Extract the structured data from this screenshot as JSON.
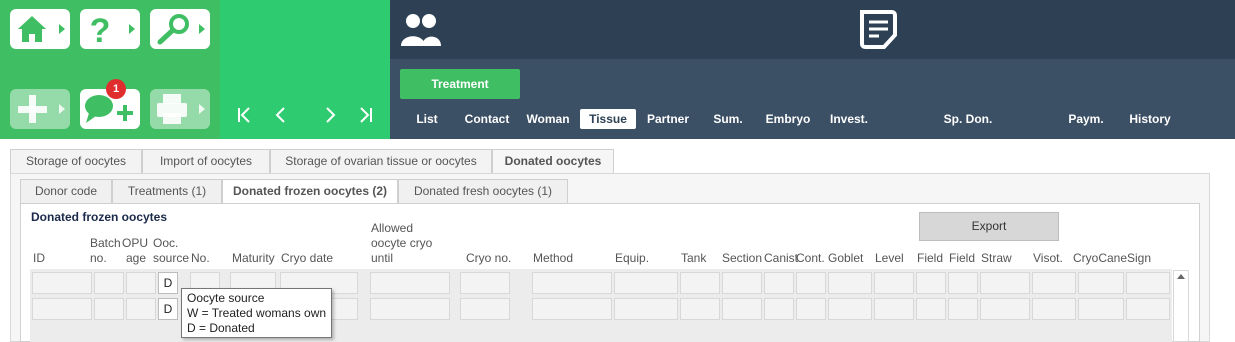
{
  "action_panel": {
    "badge_count": "1",
    "buttons": [
      {
        "icon": "home-icon"
      },
      {
        "icon": "help-icon"
      },
      {
        "icon": "search-icon"
      },
      {
        "icon": "add-icon",
        "disabled": true
      },
      {
        "icon": "add-comment-icon"
      },
      {
        "icon": "print-icon",
        "disabled": true
      }
    ]
  },
  "nav": {
    "buttons": [
      {
        "icon": "first-record-icon"
      },
      {
        "icon": "previous-record-icon"
      },
      {
        "icon": "next-record-icon"
      },
      {
        "icon": "last-record-icon"
      }
    ]
  },
  "header": {
    "treatment_label": "Treatment",
    "active_tab": "Tissue",
    "tabs": [
      "List",
      "Contact",
      "Woman",
      "Tissue",
      "Partner",
      "Sum.",
      "Embryo",
      "Invest.",
      "Sp. Don.",
      "Paym.",
      "History"
    ]
  },
  "tabs_level1": {
    "active": "Donated oocytes",
    "items": [
      "Storage of oocytes",
      "Import of oocytes",
      "Storage of ovarian tissue or oocytes",
      "Donated oocytes"
    ]
  },
  "tabs_level2": {
    "active": "Donated frozen oocytes (2)",
    "items": [
      "Donor code",
      "Treatments (1)",
      "Donated frozen oocytes (2)",
      "Donated fresh oocytes (1)"
    ]
  },
  "section": {
    "title": "Donated frozen oocytes",
    "export_label": "Export"
  },
  "table": {
    "headers": {
      "id": "ID",
      "batch_no_1": "Batch",
      "batch_no_2": "no.",
      "opu_age_1": "OPU",
      "opu_age_2": "age",
      "ooc_source_1": "Ooc.",
      "ooc_source_2": "source",
      "no": "No.",
      "maturity": "Maturity",
      "cryo_date": "Cryo date",
      "allowed_1": "Allowed",
      "allowed_2": "oocyte cryo",
      "allowed_3": "until",
      "cryo_no": "Cryo no.",
      "method": "Method",
      "equip": "Equip.",
      "tank": "Tank",
      "section": "Section",
      "canist": "Canist",
      "cont": "Cont.",
      "goblet": "Goblet",
      "level": "Level",
      "field1": "Field",
      "field2": "Field",
      "straw": "Straw",
      "visot": "Visot.",
      "cryocane": "CryoCane",
      "sign": "Sign"
    },
    "rows": [
      {
        "ooc_source": "D"
      },
      {
        "ooc_source": "D"
      }
    ]
  },
  "tooltip": {
    "title": "Oocyte source",
    "line1": "W = Treated womans own",
    "line2": "D  = Donated"
  }
}
